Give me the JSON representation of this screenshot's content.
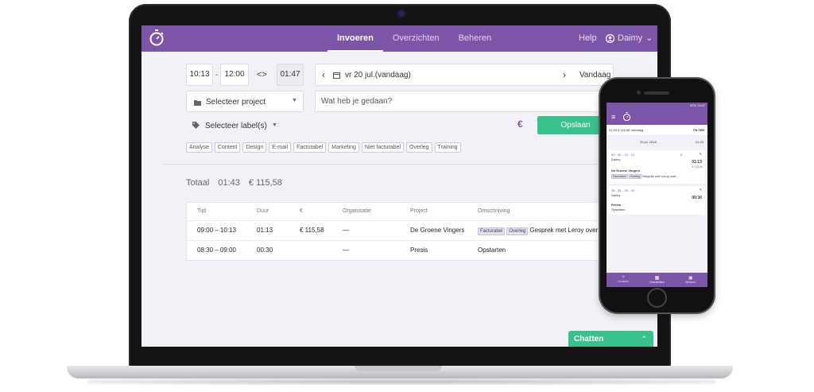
{
  "nav": {
    "items": [
      {
        "label": "Invoeren",
        "active": true
      },
      {
        "label": "Overzichten",
        "active": false
      },
      {
        "label": "Beheren",
        "active": false
      }
    ],
    "help": "Help",
    "user": "Daimy"
  },
  "entry": {
    "start": "10:13",
    "dash": "-",
    "end": "12:00",
    "swap": "<>",
    "duration": "01:47",
    "date": "vr 20 jul.(vandaag)",
    "today": "Vandaag",
    "project_placeholder": "Selecteer project",
    "description_placeholder": "Wat heb je gedaan?",
    "labels_placeholder": "Selecteer label(s)",
    "euro": "€",
    "save": "Opslaan",
    "chips": [
      "Analyse",
      "Content",
      "Design",
      "E-mail",
      "Facturabel",
      "Marketing",
      "Niet facturabel",
      "Overleg",
      "Training"
    ]
  },
  "totals": {
    "label": "Totaal",
    "time": "01:43",
    "amount": "€ 115,58"
  },
  "table": {
    "headers": [
      "Tijd",
      "Duur",
      "€",
      "Organisatie",
      "Project",
      "Omschrijving"
    ],
    "rows": [
      {
        "time": "09:00 – 10:13",
        "duration": "01:13",
        "amount": "€ 115,58",
        "org": "—",
        "project": "De Groene Vingers",
        "tags": [
          "Facturabel",
          "Overleg"
        ],
        "description": "Gesprek met Leroy over proj"
      },
      {
        "time": "08:30 – 09:00",
        "duration": "00:30",
        "amount": "",
        "org": "—",
        "project": "Presis",
        "tags": [],
        "description": "Opstarten"
      }
    ]
  },
  "chat": {
    "label": "Chatten"
  },
  "phone": {
    "status": "47% 13:47",
    "summary": "01:43 € 115,58  Vandaag",
    "filter": "FILTER",
    "date": "20 jul. 2018",
    "day_total": "01:43",
    "entries": [
      {
        "times": "09 : 00 – 10 : 13",
        "user": "Daimy",
        "tag_count": "2",
        "duration": "01:13",
        "amount": "€ 115,58",
        "project": "De Groene Vingers",
        "tags": [
          "Facturabel",
          "Overleg"
        ],
        "description": "Gesprek met Leroy over..."
      },
      {
        "times": "08 : 30 – 09 : 00",
        "user": "Daimy",
        "tag_count": "",
        "duration": "00:30",
        "amount": "",
        "project": "Presis",
        "tags": [],
        "description": "Opstarten"
      }
    ],
    "tabs": [
      "Invoeren",
      "Overzichten",
      "Beheren"
    ]
  },
  "colors": {
    "primary": "#7d55a8",
    "accent": "#3ac28c",
    "background": "#f2f1f8"
  }
}
